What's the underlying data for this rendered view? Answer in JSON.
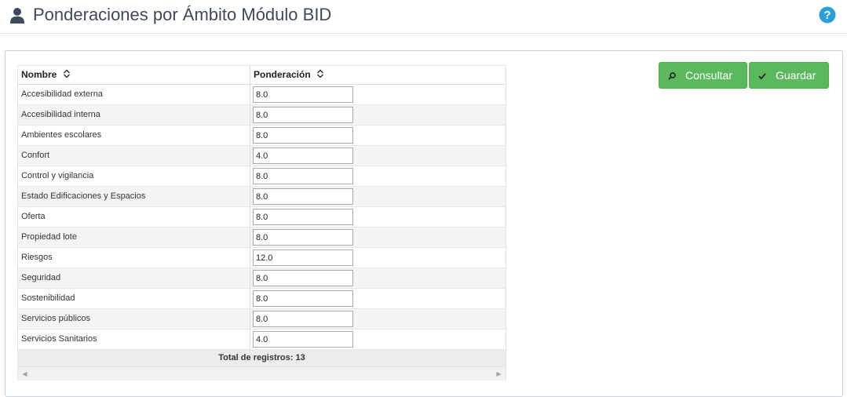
{
  "header": {
    "title": "Ponderaciones por Ámbito Módulo BID",
    "user_icon": "user-icon",
    "help_icon": "question-circle-icon",
    "title_color": "#3d4a5c",
    "help_color": "#2b9fd8"
  },
  "actions": {
    "consultar_label": "Consultar",
    "consultar_icon": "search-icon",
    "guardar_label": "Guardar",
    "guardar_icon": "check-icon",
    "button_color": "#5cb85c"
  },
  "grid": {
    "columns": [
      {
        "label": "Nombre",
        "sort_icon": "sort-icon"
      },
      {
        "label": "Ponderación",
        "sort_icon": "sort-icon"
      }
    ],
    "rows": [
      {
        "nombre": "Accesibilidad externa",
        "ponderacion": "8.0"
      },
      {
        "nombre": "Accesibilidad interna",
        "ponderacion": "8.0"
      },
      {
        "nombre": "Ambientes escolares",
        "ponderacion": "8.0"
      },
      {
        "nombre": "Confort",
        "ponderacion": "4.0"
      },
      {
        "nombre": "Control y vigilancia",
        "ponderacion": "8.0"
      },
      {
        "nombre": "Estado Edificaciones y Espacios",
        "ponderacion": "8.0"
      },
      {
        "nombre": "Oferta",
        "ponderacion": "8.0"
      },
      {
        "nombre": "Propiedad lote",
        "ponderacion": "8.0"
      },
      {
        "nombre": "Riesgos",
        "ponderacion": "12.0"
      },
      {
        "nombre": "Seguridad",
        "ponderacion": "8.0"
      },
      {
        "nombre": "Sostenibilidad",
        "ponderacion": "8.0"
      },
      {
        "nombre": "Servicios públicos",
        "ponderacion": "8.0"
      },
      {
        "nombre": "Servicios Sanitarios",
        "ponderacion": "4.0"
      }
    ],
    "footer_text": "Total de registros: 13"
  }
}
